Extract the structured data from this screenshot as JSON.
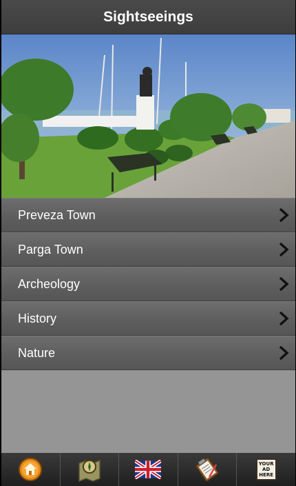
{
  "header": {
    "title": "Sightseeings"
  },
  "hero": {
    "image": "promenade-with-statue-and-benches"
  },
  "menu": {
    "items": [
      {
        "label": "Preveza Town",
        "icon": "chevron-right-icon"
      },
      {
        "label": "Parga Town",
        "icon": "chevron-right-icon"
      },
      {
        "label": "Archeology",
        "icon": "chevron-right-icon"
      },
      {
        "label": "History",
        "icon": "chevron-right-icon"
      },
      {
        "label": "Nature",
        "icon": "chevron-right-icon"
      }
    ]
  },
  "tabbar": {
    "tabs": [
      {
        "icon": "home-icon"
      },
      {
        "icon": "map-compass-icon"
      },
      {
        "icon": "uk-flag-icon"
      },
      {
        "icon": "clipboard-icon"
      },
      {
        "icon": "ad-sign-icon",
        "text_line1": "YOUR AD",
        "text_line2": "HERE"
      }
    ]
  },
  "colors": {
    "titlebar": "#434343",
    "menu_item": "#606060",
    "background": "#8e8e8e",
    "tabbar": "#2c2c2c"
  }
}
